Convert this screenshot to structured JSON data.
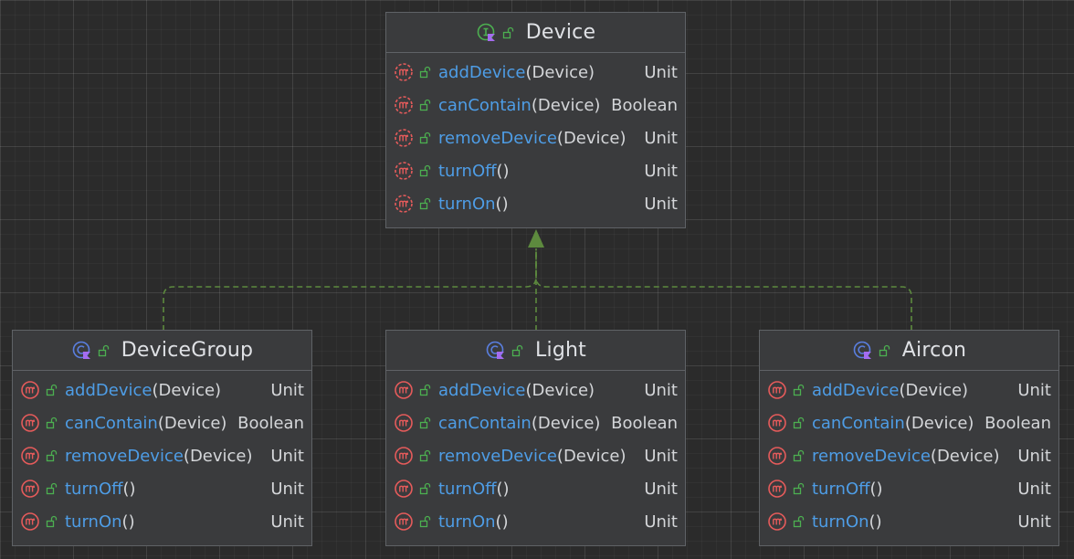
{
  "colors": {
    "background": "#2b2b2b",
    "node_fill": "#3a3b3d",
    "node_border": "#5f6266",
    "method_name": "#4e9de6",
    "text": "#d4d6d9",
    "method_icon": "#e55b5b",
    "interface_icon": "#4caf50",
    "class_icon": "#5a7fe0",
    "kotlin_badge": "#a56cf0",
    "edge": "#5d8a3e"
  },
  "nodes": [
    {
      "id": "device",
      "title": "Device",
      "kind": "interface",
      "kind_icon": "interface-icon",
      "members": [
        {
          "name": "addDevice",
          "params": "(Device)",
          "type": "Unit",
          "icon": "abstract-method-icon"
        },
        {
          "name": "canContain",
          "params": "(Device)",
          "type": "Boolean",
          "icon": "abstract-method-icon"
        },
        {
          "name": "removeDevice",
          "params": "(Device)",
          "type": "Unit",
          "icon": "abstract-method-icon"
        },
        {
          "name": "turnOff",
          "params": "()",
          "type": "Unit",
          "icon": "abstract-method-icon"
        },
        {
          "name": "turnOn",
          "params": "()",
          "type": "Unit",
          "icon": "abstract-method-icon"
        }
      ]
    },
    {
      "id": "devicegroup",
      "title": "DeviceGroup",
      "kind": "class",
      "kind_icon": "class-icon",
      "members": [
        {
          "name": "addDevice",
          "params": "(Device)",
          "type": "Unit",
          "icon": "method-icon"
        },
        {
          "name": "canContain",
          "params": "(Device)",
          "type": "Boolean",
          "icon": "method-icon"
        },
        {
          "name": "removeDevice",
          "params": "(Device)",
          "type": "Unit",
          "icon": "method-icon"
        },
        {
          "name": "turnOff",
          "params": "()",
          "type": "Unit",
          "icon": "method-icon"
        },
        {
          "name": "turnOn",
          "params": "()",
          "type": "Unit",
          "icon": "method-icon"
        }
      ]
    },
    {
      "id": "light",
      "title": "Light",
      "kind": "class",
      "kind_icon": "class-icon",
      "members": [
        {
          "name": "addDevice",
          "params": "(Device)",
          "type": "Unit",
          "icon": "method-icon"
        },
        {
          "name": "canContain",
          "params": "(Device)",
          "type": "Boolean",
          "icon": "method-icon"
        },
        {
          "name": "removeDevice",
          "params": "(Device)",
          "type": "Unit",
          "icon": "method-icon"
        },
        {
          "name": "turnOff",
          "params": "()",
          "type": "Unit",
          "icon": "method-icon"
        },
        {
          "name": "turnOn",
          "params": "()",
          "type": "Unit",
          "icon": "method-icon"
        }
      ]
    },
    {
      "id": "aircon",
      "title": "Aircon",
      "kind": "class",
      "kind_icon": "class-icon",
      "members": [
        {
          "name": "addDevice",
          "params": "(Device)",
          "type": "Unit",
          "icon": "method-icon"
        },
        {
          "name": "canContain",
          "params": "(Device)",
          "type": "Boolean",
          "icon": "method-icon"
        },
        {
          "name": "removeDevice",
          "params": "(Device)",
          "type": "Unit",
          "icon": "method-icon"
        },
        {
          "name": "turnOff",
          "params": "()",
          "type": "Unit",
          "icon": "method-icon"
        },
        {
          "name": "turnOn",
          "params": "()",
          "type": "Unit",
          "icon": "method-icon"
        }
      ]
    }
  ],
  "edges": [
    {
      "from": "devicegroup",
      "to": "device",
      "type": "implements"
    },
    {
      "from": "light",
      "to": "device",
      "type": "implements"
    },
    {
      "from": "aircon",
      "to": "device",
      "type": "implements"
    }
  ]
}
